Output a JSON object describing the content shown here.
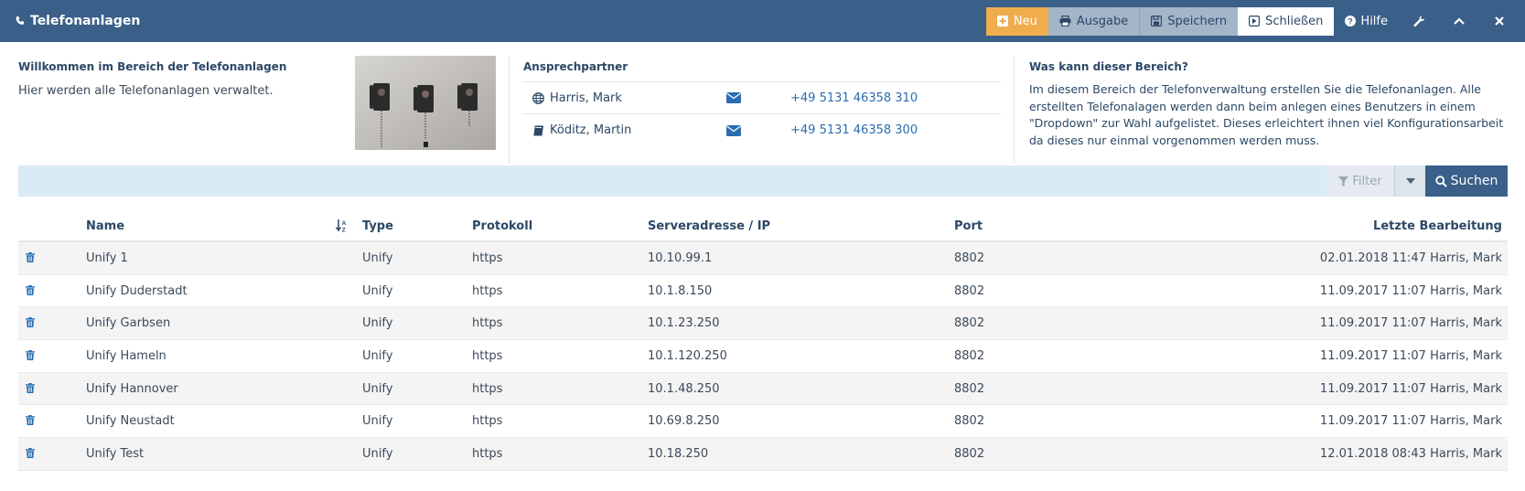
{
  "header": {
    "title": "Telefonanlagen",
    "title_icon": "phone-icon",
    "buttons": {
      "new": "Neu",
      "output": "Ausgabe",
      "save": "Speichern",
      "close": "Schließen",
      "help": "Hilfe"
    },
    "colors": {
      "bar": "#3a5f88",
      "new": "#f0ad4e",
      "secondary": "#a4b5c8"
    }
  },
  "welcome": {
    "title": "Willkommen im Bereich der Telefonanlagen",
    "text": "Hier werden alle Telefonanlagen verwaltet."
  },
  "contacts": {
    "title": "Ansprechpartner",
    "items": [
      {
        "name": "Harris, Mark",
        "icon": "globe-icon",
        "phone": "+49 5131 46358 310"
      },
      {
        "name": "Köditz, Martin",
        "icon": "book-icon",
        "phone": "+49 5131 46358 300"
      }
    ]
  },
  "about": {
    "title": "Was kann dieser Bereich?",
    "text": "Im diesem Bereich der Telefonverwaltung erstellen Sie die Telefonanlagen. Alle erstellten Telefonalagen werden dann beim anlegen eines Benutzers in einem \"Dropdown\" zur Wahl aufgelistet. Dieses erleichtert ihnen viel Konfigurationsarbeit da dieses nur einmal vorgenommen werden muss."
  },
  "filterbar": {
    "filter": "Filter",
    "search": "Suchen"
  },
  "table": {
    "headers": {
      "name": "Name",
      "type": "Type",
      "protocol": "Protokoll",
      "server": "Serveradresse / IP",
      "port": "Port",
      "last_edit": "Letzte Bearbeitung"
    },
    "rows": [
      {
        "name": "Unify 1",
        "type": "Unify",
        "protocol": "https",
        "server": "10.10.99.1",
        "port": "8802",
        "last_edit": "02.01.2018 11:47 Harris, Mark"
      },
      {
        "name": "Unify Duderstadt",
        "type": "Unify",
        "protocol": "https",
        "server": "10.1.8.150",
        "port": "8802",
        "last_edit": "11.09.2017 11:07 Harris, Mark"
      },
      {
        "name": "Unify Garbsen",
        "type": "Unify",
        "protocol": "https",
        "server": "10.1.23.250",
        "port": "8802",
        "last_edit": "11.09.2017 11:07 Harris, Mark"
      },
      {
        "name": "Unify Hameln",
        "type": "Unify",
        "protocol": "https",
        "server": "10.1.120.250",
        "port": "8802",
        "last_edit": "11.09.2017 11:07 Harris, Mark"
      },
      {
        "name": "Unify Hannover",
        "type": "Unify",
        "protocol": "https",
        "server": "10.1.48.250",
        "port": "8802",
        "last_edit": "11.09.2017 11:07 Harris, Mark"
      },
      {
        "name": "Unify Neustadt",
        "type": "Unify",
        "protocol": "https",
        "server": "10.69.8.250",
        "port": "8802",
        "last_edit": "11.09.2017 11:07 Harris, Mark"
      },
      {
        "name": "Unify Test",
        "type": "Unify",
        "protocol": "https",
        "server": "10.18.250",
        "port": "8802",
        "last_edit": "12.01.2018 08:43 Harris, Mark"
      }
    ]
  }
}
